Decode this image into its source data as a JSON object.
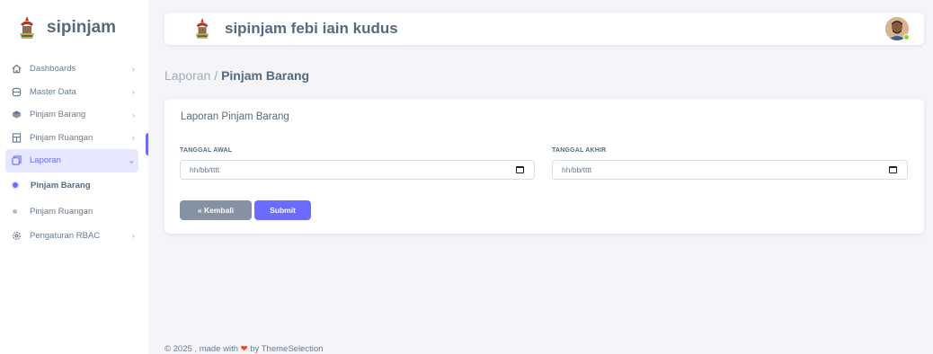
{
  "sidebar": {
    "brand": "sipinjam",
    "items": [
      {
        "label": "Dashboards",
        "icon": "home-icon",
        "chevron": "›"
      },
      {
        "label": "Master Data",
        "icon": "database-icon",
        "chevron": "›"
      },
      {
        "label": "Pinjam Barang",
        "icon": "box-icon",
        "chevron": "›"
      },
      {
        "label": "Pinjam Ruangan",
        "icon": "door-icon",
        "chevron": "›"
      },
      {
        "label": "Laporan",
        "icon": "report-icon",
        "chevron": "⌄"
      },
      {
        "label": "Pengaturan RBAC",
        "icon": "settings-icon",
        "chevron": "›"
      }
    ],
    "subitems": [
      {
        "label": "Pinjam Barang"
      },
      {
        "label": "Pinjam Ruangan"
      }
    ]
  },
  "navbar": {
    "title": "sipinjam febi iain kudus"
  },
  "breadcrumb": {
    "parent": "Laporan /",
    "current": "Pinjam Barang"
  },
  "card": {
    "title": "Laporan Pinjam Barang",
    "start_label": "TANGGAL AWAL",
    "start_placeholder": "hh/bb/tttt",
    "end_label": "TANGGAL AKHIR",
    "end_placeholder": "hh/bb/tttt",
    "back_label": "« Kembali",
    "submit_label": "Submit"
  },
  "footer": {
    "prefix": "© 2025 , made with",
    "heart": "❤",
    "suffix": "by ThemeSelection"
  },
  "colors": {
    "accent": "#696cff",
    "secondary": "#8592a3",
    "background": "#f5f5f9"
  }
}
